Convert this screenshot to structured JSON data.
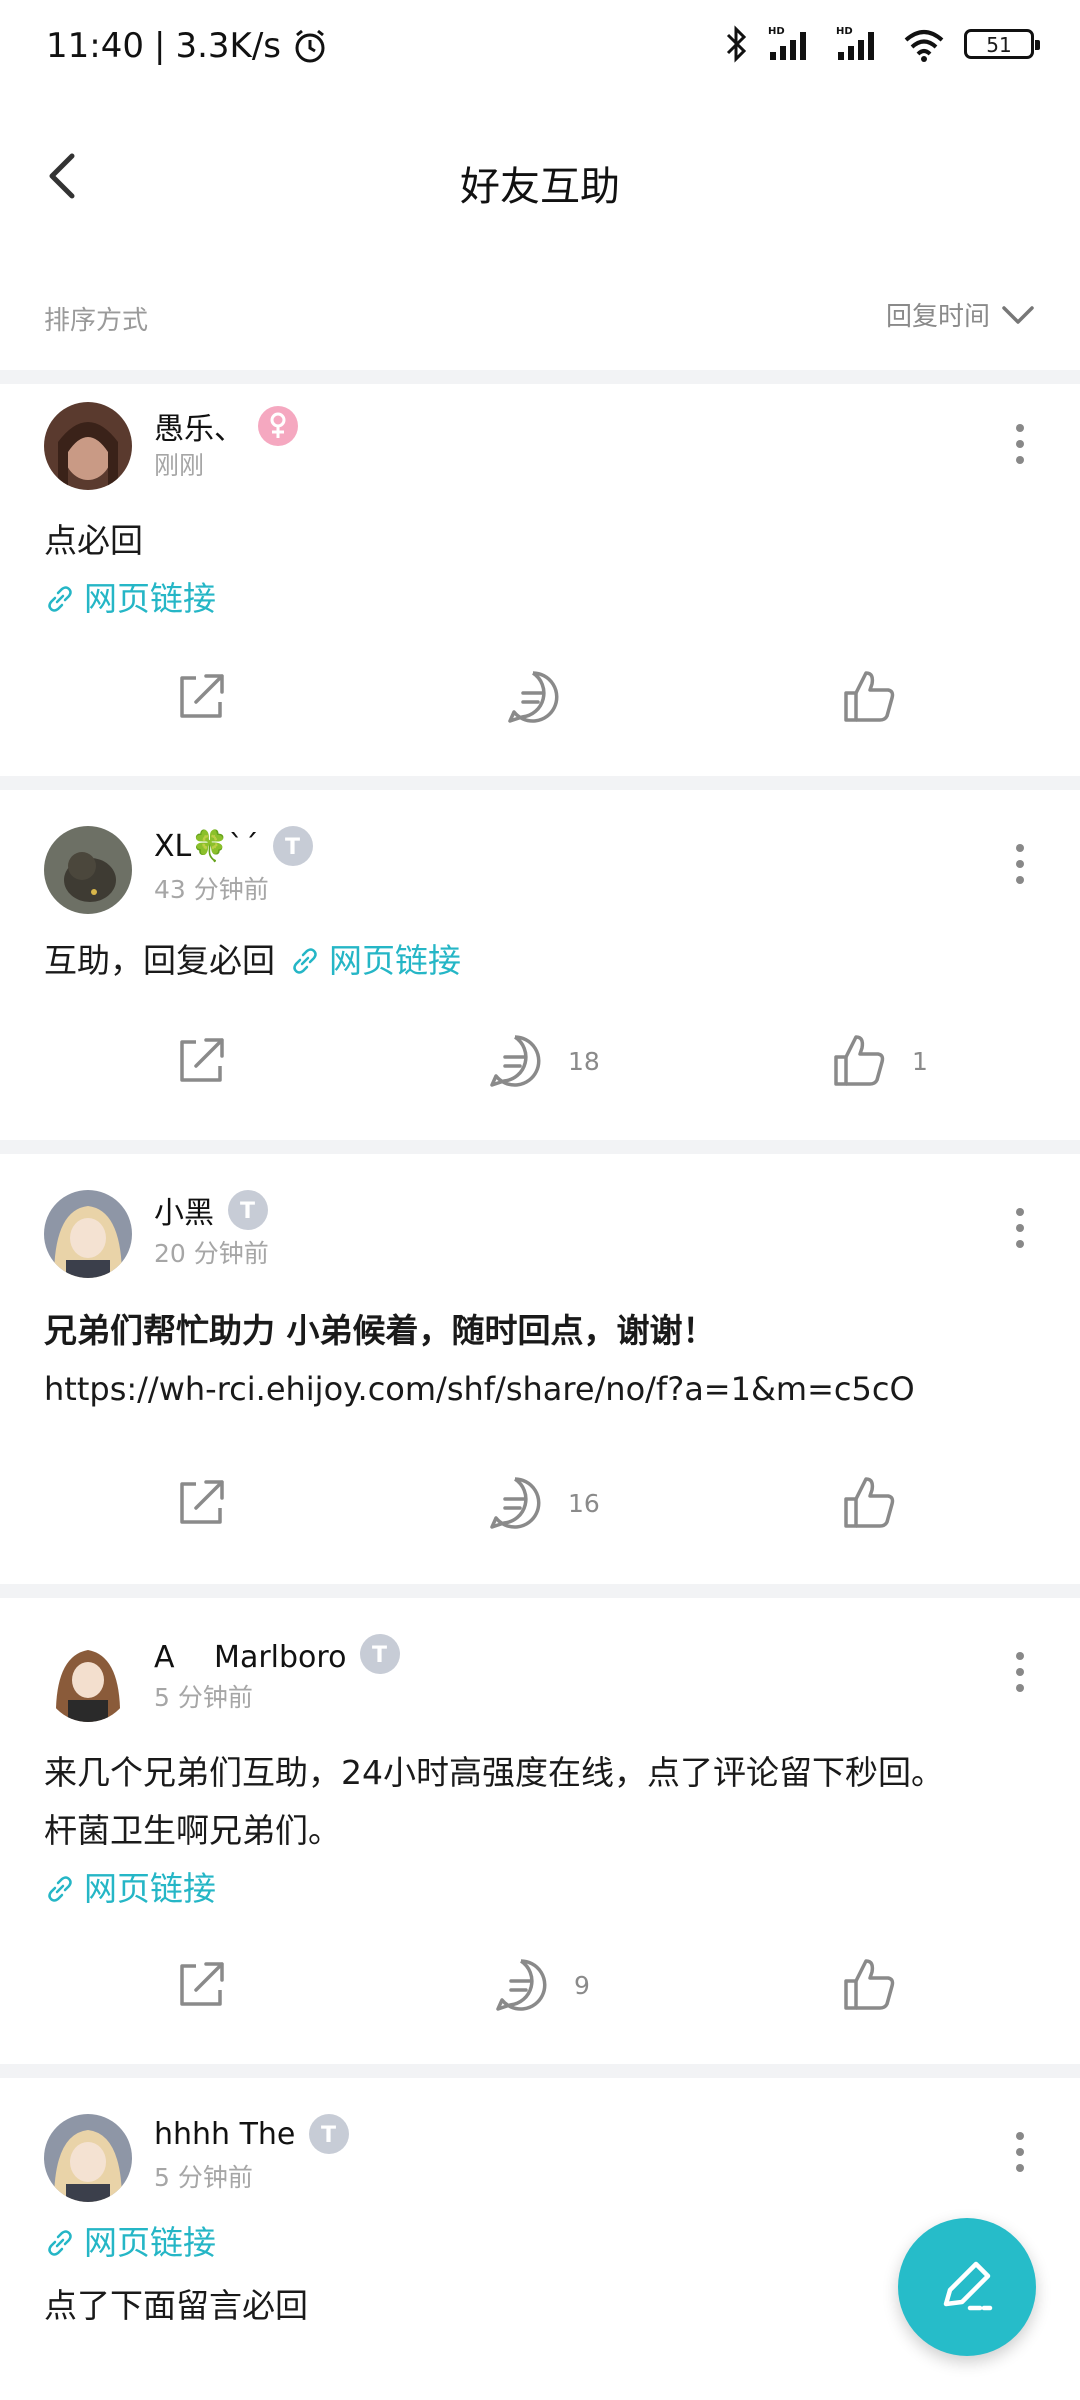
{
  "status_bar": {
    "time": "11:40",
    "separator": "|",
    "net_speed": "3.3K/s",
    "battery": "51"
  },
  "header": {
    "title": "好友互助"
  },
  "sort": {
    "label": "排序方式",
    "value": "回复时间"
  },
  "posts": [
    {
      "username": "愚乐、",
      "time": "刚刚",
      "text": "点必回",
      "link_label": "网页链接",
      "comments": "",
      "likes": ""
    },
    {
      "username": "XL🍀ˋˊ",
      "time": "43 分钟前",
      "text": "互助，回复必回",
      "link_label": "网页链接",
      "comments": "18",
      "likes": "1"
    },
    {
      "username": "小黑",
      "time": "20 分钟前",
      "text": "兄弟们帮忙助力 小弟候着，随时回点，谢谢！",
      "url_text": "https://wh-rci.ehijoy.com/shf/share/no/f?a=1&m=c5cO",
      "comments": "16",
      "likes": ""
    },
    {
      "username": "A　 Marlboro",
      "time": "5 分钟前",
      "text_line1": "来几个兄弟们互助，24小时高强度在线，点了评论留下秒回。",
      "text_line2": "杆菌卫生啊兄弟们。",
      "link_label": "网页链接",
      "comments": "9",
      "likes": ""
    },
    {
      "username": "hhhh The",
      "time": "5 分钟前",
      "link_label": "网页链接",
      "text": "点了下面留言必回"
    }
  ],
  "colors": {
    "accent": "#25b6c6",
    "muted": "#8a8a8a",
    "divider": "#f2f3f5"
  },
  "icons": [
    "back-icon",
    "more-icon",
    "share-icon",
    "comment-icon",
    "like-icon",
    "link-icon",
    "edit-icon"
  ]
}
